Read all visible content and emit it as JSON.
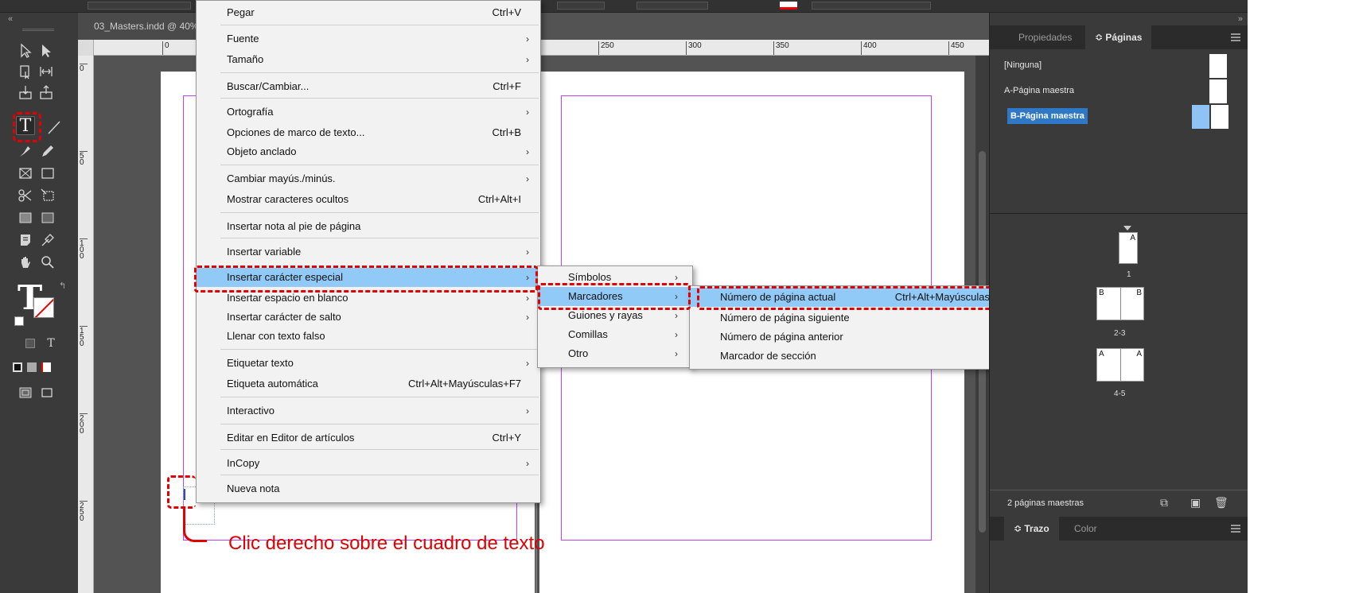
{
  "document": {
    "tab_title": "03_Masters.indd @ 40%",
    "ruler_h": [
      "0",
      "250",
      "300",
      "350",
      "400",
      "450"
    ],
    "ruler_v": [
      "0",
      "50",
      "100",
      "150",
      "200",
      "250"
    ]
  },
  "context_menu": {
    "items": [
      {
        "label": "Pegar",
        "shortcut": "Ctrl+V",
        "submenu": false
      },
      {
        "label": "Fuente",
        "shortcut": "",
        "submenu": true
      },
      {
        "label": "Tamaño",
        "shortcut": "",
        "submenu": true
      },
      {
        "label": "Buscar/Cambiar...",
        "shortcut": "Ctrl+F",
        "submenu": false
      },
      {
        "label": "Ortografía",
        "shortcut": "",
        "submenu": true
      },
      {
        "label": "Opciones de marco de texto...",
        "shortcut": "Ctrl+B",
        "submenu": false
      },
      {
        "label": "Objeto anclado",
        "shortcut": "",
        "submenu": true
      },
      {
        "label": "Cambiar mayús./minús.",
        "shortcut": "",
        "submenu": true
      },
      {
        "label": "Mostrar caracteres ocultos",
        "shortcut": "Ctrl+Alt+I",
        "submenu": false
      },
      {
        "label": "Insertar nota al pie de página",
        "shortcut": "",
        "submenu": false
      },
      {
        "label": "Insertar variable",
        "shortcut": "",
        "submenu": true
      },
      {
        "label": "Insertar carácter especial",
        "shortcut": "",
        "submenu": true
      },
      {
        "label": "Insertar espacio en blanco",
        "shortcut": "",
        "submenu": true
      },
      {
        "label": "Insertar carácter de salto",
        "shortcut": "",
        "submenu": true
      },
      {
        "label": "Llenar con texto falso",
        "shortcut": "",
        "submenu": false
      },
      {
        "label": "Etiquetar texto",
        "shortcut": "",
        "submenu": true
      },
      {
        "label": "Etiqueta automática",
        "shortcut": "Ctrl+Alt+Mayúsculas+F7",
        "submenu": false
      },
      {
        "label": "Interactivo",
        "shortcut": "",
        "submenu": true
      },
      {
        "label": "Editar en Editor de artículos",
        "shortcut": "Ctrl+Y",
        "submenu": false
      },
      {
        "label": "InCopy",
        "shortcut": "",
        "submenu": true
      },
      {
        "label": "Nueva nota",
        "shortcut": "",
        "submenu": false
      }
    ]
  },
  "submenu_special": {
    "items": [
      "Símbolos",
      "Marcadores",
      "Guiones y rayas",
      "Comillas",
      "Otro"
    ]
  },
  "submenu_markers": {
    "items": [
      {
        "label": "Número de página actual",
        "shortcut": "Ctrl+Alt+Mayúsculas+N"
      },
      {
        "label": "Número de página siguiente",
        "shortcut": ""
      },
      {
        "label": "Número de página anterior",
        "shortcut": ""
      },
      {
        "label": "Marcador de sección",
        "shortcut": ""
      }
    ]
  },
  "pages_panel": {
    "tab_properties": "Propiedades",
    "tab_pages": "Páginas",
    "masters": [
      "[Ninguna]",
      "A-Página maestra",
      "B-Página maestra"
    ],
    "page_1_master": "A",
    "spread_2_3_masters": [
      "B",
      "B"
    ],
    "spread_4_5_masters": [
      "A",
      "A"
    ],
    "page_labels": [
      "1",
      "2-3",
      "4-5"
    ],
    "footer_text": "2 páginas maestras",
    "tab_stroke": "Trazo",
    "tab_color": "Color"
  },
  "annotation": {
    "caption": "Clic derecho sobre el cuadro de texto",
    "color": "#e20000"
  },
  "colors": {
    "menu_highlight": "#91c9f7",
    "panel_bg": "#3a3a3a",
    "margin_guide": "#c040ff"
  }
}
